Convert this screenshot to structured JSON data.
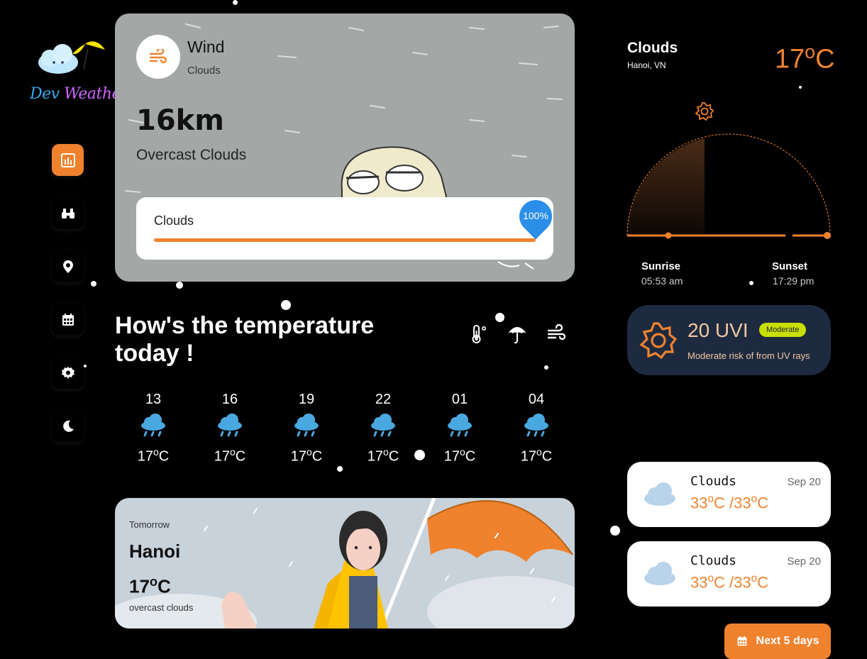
{
  "app": {
    "logo_text_1": "Dev",
    "logo_text_2": "Weather"
  },
  "sidebar": {
    "items": [
      {
        "icon": "chart-icon",
        "active": true
      },
      {
        "icon": "binoculars-icon",
        "active": false
      },
      {
        "icon": "map-pin-icon",
        "active": false
      },
      {
        "icon": "calendar-icon",
        "active": false
      },
      {
        "icon": "gear-icon",
        "active": false
      },
      {
        "icon": "moon-icon",
        "active": false
      }
    ]
  },
  "wind_card": {
    "title": "Wind",
    "subtitle": "Clouds",
    "value": "16km",
    "description": "Overcast Clouds",
    "cloud_label": "Clouds",
    "cloud_percent": "100%",
    "cloud_fraction": 1.0
  },
  "temperature": {
    "heading": "How's the temperature today !",
    "hours": [
      {
        "time": "13",
        "temp": "17",
        "unit": "C",
        "icon": "rain-cloud-icon"
      },
      {
        "time": "16",
        "temp": "17",
        "unit": "C",
        "icon": "rain-cloud-icon"
      },
      {
        "time": "19",
        "temp": "17",
        "unit": "C",
        "icon": "rain-cloud-icon"
      },
      {
        "time": "22",
        "temp": "17",
        "unit": "C",
        "icon": "rain-cloud-icon"
      },
      {
        "time": "01",
        "temp": "17",
        "unit": "C",
        "icon": "rain-cloud-icon"
      },
      {
        "time": "04",
        "temp": "17",
        "unit": "C",
        "icon": "rain-cloud-icon"
      }
    ]
  },
  "tomorrow": {
    "label": "Tomorrow",
    "city": "Hanoi",
    "temp": "17",
    "unit": "C",
    "description": "overcast clouds"
  },
  "current": {
    "condition": "Clouds",
    "location": "Hanoi, VN",
    "temp": "17",
    "unit": "C"
  },
  "sun": {
    "sunrise_label": "Sunrise",
    "sunrise_time": "05:53 am",
    "sunset_label": "Sunset",
    "sunset_time": "17:29 pm"
  },
  "uv": {
    "value": "20 UVI",
    "badge": "Moderate",
    "description": "Moderate risk of from UV rays"
  },
  "forecast": [
    {
      "condition": "Clouds",
      "date": "Sep 20",
      "high": "33",
      "low": "33",
      "unit": "C"
    },
    {
      "condition": "Clouds",
      "date": "Sep 20",
      "high": "33",
      "low": "33",
      "unit": "C"
    }
  ],
  "next_button": {
    "label": "Next 5 days"
  },
  "colors": {
    "accent": "#f0822d",
    "uv_card": "#1e2a40",
    "badge": "#c8e000",
    "progress_pin": "#2b8ee8"
  }
}
